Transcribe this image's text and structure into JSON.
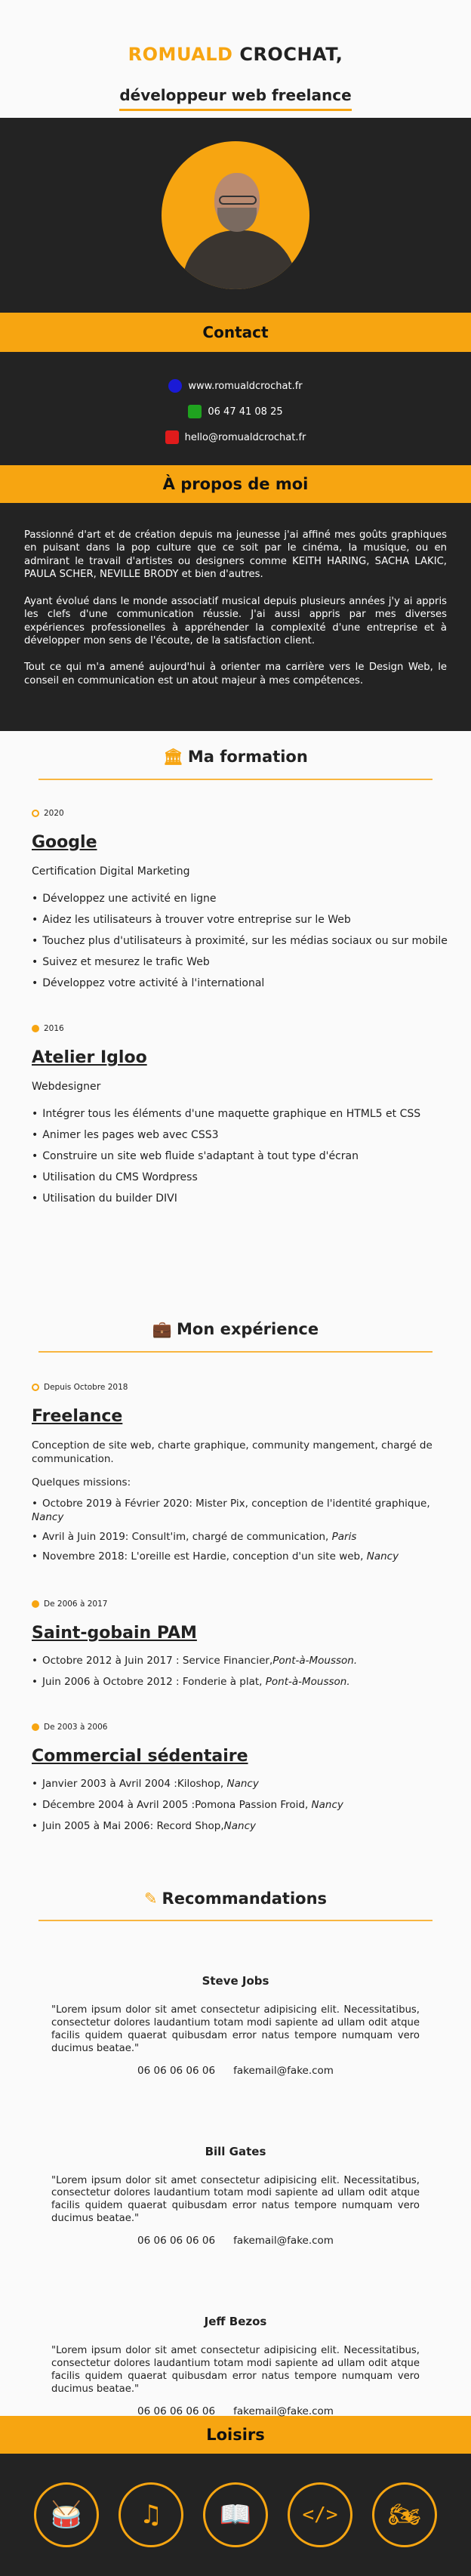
{
  "header": {
    "first_name": "ROMUALD",
    "last_name": " CROCHAT,",
    "tagline": "développeur web freelance"
  },
  "contact": {
    "title": "Contact",
    "website": "www.romualdcrochat.fr",
    "phone": "06 47 41 08 25",
    "email": "hello@romualdcrochat.fr",
    "colors": {
      "website_icon": "#1a1ad6",
      "phone_icon": "#1fa31f",
      "email_icon": "#e01b1b"
    }
  },
  "about": {
    "title": "À propos de moi",
    "p1": "Passionné d'art et de création depuis ma jeunesse j'ai affiné mes goûts graphiques en puisant dans la pop culture que ce soit par le cinéma, la musique, ou en admirant le travail d'artistes ou designers comme KEITH HARING, SACHA LAKIC, PAULA SCHER, NEVILLE BRODY et bien d'autres.",
    "p2": "Ayant évolué dans le monde associatif musical depuis plusieurs années j'y ai appris les clefs d'une communication réussie. J'ai aussi appris par mes diverses expériences professionelles à appréhender la complexité d'une entreprise et à développer mon sens de l'écoute, de la satisfaction client.",
    "p3": "Tout ce qui m'a amené aujourd'hui à orienter ma carrière vers le Design Web, le conseil en communication est un atout majeur à mes compétences."
  },
  "formation": {
    "title": "Ma formation",
    "entries": [
      {
        "date": "2020",
        "title": "Google",
        "subtitle": "Certification Digital Marketing",
        "items": [
          "Développez une activité en ligne",
          "Aidez les utilisateurs à trouver votre entreprise sur le Web",
          "Touchez plus d'utilisateurs à proximité, sur les médias sociaux ou sur mobile",
          "Suivez et mesurez le trafic Web",
          "Développez votre activité à l'international"
        ]
      },
      {
        "date": "2016",
        "title": "Atelier Igloo",
        "subtitle": "Webdesigner",
        "items": [
          "Intégrer tous les éléments d'une maquette graphique en HTML5 et CSS",
          "Animer les pages web avec CSS3",
          "Construire un site web fluide s'adaptant à tout type d'écran",
          "Utilisation du CMS Wordpress",
          "Utilisation du builder DIVI"
        ]
      }
    ]
  },
  "experience": {
    "title": "Mon expérience",
    "freelance": {
      "date": "Depuis Octobre 2018",
      "title": "Freelance",
      "desc": "Conception de site web, charte graphique, community mangement, chargé de communication.",
      "missions_label": "Quelques missions:",
      "m1a": "Octobre 2019 à Février 2020: Mister Pix, conception de l'identité graphique,",
      "m1b": "Nancy",
      "m2a": "Avril à Juin 2019: Consult'im, chargé de communication,",
      "m2b": "Paris",
      "m3a": "Novembre 2018: L'oreille est Hardie, conception d'un site web,",
      "m3b": "Nancy"
    },
    "pam": {
      "date": "De 2006 à 2017",
      "title": "Saint-gobain PAM",
      "i1a": "Octobre 2012 à Juin 2017 : Service Financier,",
      "i1b": "Pont-à-Mousson.",
      "i2a": "Juin 2006 à Octobre 2012 : Fonderie à plat,",
      "i2b": "Pont-à-Mousson."
    },
    "commercial": {
      "date": "De 2003 à 2006",
      "title": "Commercial sédentaire",
      "i1a": "Janvier 2003 à Avril 2004 :Kiloshop,",
      "i1b": "Nancy",
      "i2a": "Décembre 2004 à Avril 2005 :Pomona Passion Froid,",
      "i2b": "Nancy",
      "i3a": "Juin 2005 à Mai 2006: Record Shop,",
      "i3b": "Nancy"
    }
  },
  "recommendations": {
    "title": "Recommandations",
    "items": [
      {
        "name": "Steve Jobs",
        "quote": "\"Lorem ipsum dolor sit amet consectetur adipisicing elit. Necessitatibus, consectetur dolores laudantium totam modi sapiente ad ullam odit atque facilis quidem quaerat quibusdam error natus tempore numquam vero ducimus beatae.\"",
        "phone": "06 06 06 06 06",
        "email": "fakemail@fake.com"
      },
      {
        "name": "Bill Gates",
        "quote": "\"Lorem ipsum dolor sit amet consectetur adipisicing elit. Necessitatibus, consectetur dolores laudantium totam modi sapiente ad ullam odit atque facilis quidem quaerat quibusdam error natus tempore numquam vero ducimus beatae.\"",
        "phone": "06 06 06 06 06",
        "email": "fakemail@fake.com"
      },
      {
        "name": "Jeff Bezos",
        "quote": "\"Lorem ipsum dolor sit amet consectetur adipisicing elit. Necessitatibus, consectetur dolores laudantium totam modi sapiente ad ullam odit atque facilis quidem quaerat quibusdam error natus tempore numquam vero ducimus beatae.\"",
        "phone": "06 06 06 06 06",
        "email": "fakemail@fake.com"
      }
    ]
  },
  "hobbies": {
    "title": "Loisirs",
    "icons": [
      "drum-icon",
      "music-note-icon",
      "book-icon",
      "code-icon",
      "motorcycle-icon"
    ],
    "accent": "#f7a511"
  }
}
